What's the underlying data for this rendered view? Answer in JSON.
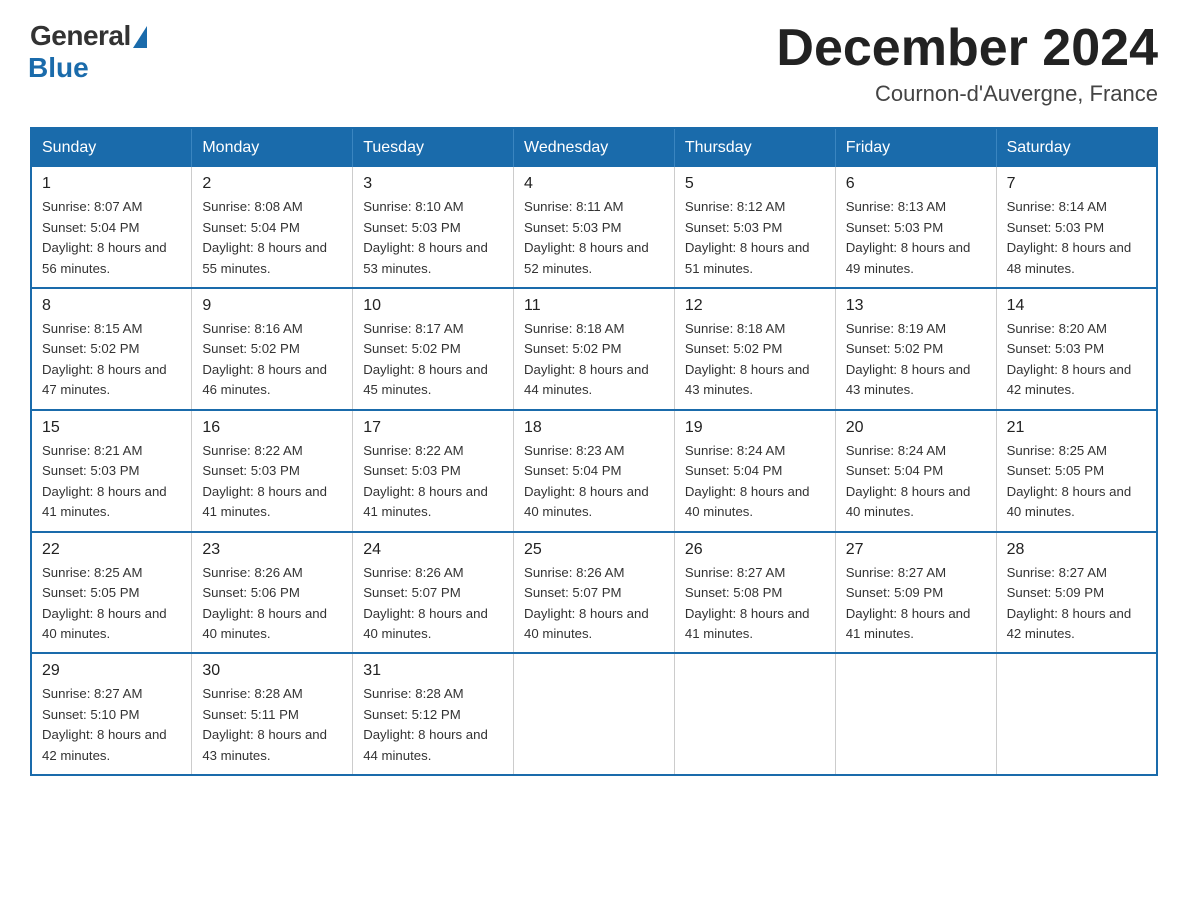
{
  "header": {
    "logo": {
      "general": "General",
      "blue": "Blue"
    },
    "title": "December 2024",
    "location": "Cournon-d'Auvergne, France"
  },
  "days_of_week": [
    "Sunday",
    "Monday",
    "Tuesday",
    "Wednesday",
    "Thursday",
    "Friday",
    "Saturday"
  ],
  "weeks": [
    [
      {
        "day": 1,
        "sunrise": "8:07 AM",
        "sunset": "5:04 PM",
        "daylight": "8 hours and 56 minutes."
      },
      {
        "day": 2,
        "sunrise": "8:08 AM",
        "sunset": "5:04 PM",
        "daylight": "8 hours and 55 minutes."
      },
      {
        "day": 3,
        "sunrise": "8:10 AM",
        "sunset": "5:03 PM",
        "daylight": "8 hours and 53 minutes."
      },
      {
        "day": 4,
        "sunrise": "8:11 AM",
        "sunset": "5:03 PM",
        "daylight": "8 hours and 52 minutes."
      },
      {
        "day": 5,
        "sunrise": "8:12 AM",
        "sunset": "5:03 PM",
        "daylight": "8 hours and 51 minutes."
      },
      {
        "day": 6,
        "sunrise": "8:13 AM",
        "sunset": "5:03 PM",
        "daylight": "8 hours and 49 minutes."
      },
      {
        "day": 7,
        "sunrise": "8:14 AM",
        "sunset": "5:03 PM",
        "daylight": "8 hours and 48 minutes."
      }
    ],
    [
      {
        "day": 8,
        "sunrise": "8:15 AM",
        "sunset": "5:02 PM",
        "daylight": "8 hours and 47 minutes."
      },
      {
        "day": 9,
        "sunrise": "8:16 AM",
        "sunset": "5:02 PM",
        "daylight": "8 hours and 46 minutes."
      },
      {
        "day": 10,
        "sunrise": "8:17 AM",
        "sunset": "5:02 PM",
        "daylight": "8 hours and 45 minutes."
      },
      {
        "day": 11,
        "sunrise": "8:18 AM",
        "sunset": "5:02 PM",
        "daylight": "8 hours and 44 minutes."
      },
      {
        "day": 12,
        "sunrise": "8:18 AM",
        "sunset": "5:02 PM",
        "daylight": "8 hours and 43 minutes."
      },
      {
        "day": 13,
        "sunrise": "8:19 AM",
        "sunset": "5:02 PM",
        "daylight": "8 hours and 43 minutes."
      },
      {
        "day": 14,
        "sunrise": "8:20 AM",
        "sunset": "5:03 PM",
        "daylight": "8 hours and 42 minutes."
      }
    ],
    [
      {
        "day": 15,
        "sunrise": "8:21 AM",
        "sunset": "5:03 PM",
        "daylight": "8 hours and 41 minutes."
      },
      {
        "day": 16,
        "sunrise": "8:22 AM",
        "sunset": "5:03 PM",
        "daylight": "8 hours and 41 minutes."
      },
      {
        "day": 17,
        "sunrise": "8:22 AM",
        "sunset": "5:03 PM",
        "daylight": "8 hours and 41 minutes."
      },
      {
        "day": 18,
        "sunrise": "8:23 AM",
        "sunset": "5:04 PM",
        "daylight": "8 hours and 40 minutes."
      },
      {
        "day": 19,
        "sunrise": "8:24 AM",
        "sunset": "5:04 PM",
        "daylight": "8 hours and 40 minutes."
      },
      {
        "day": 20,
        "sunrise": "8:24 AM",
        "sunset": "5:04 PM",
        "daylight": "8 hours and 40 minutes."
      },
      {
        "day": 21,
        "sunrise": "8:25 AM",
        "sunset": "5:05 PM",
        "daylight": "8 hours and 40 minutes."
      }
    ],
    [
      {
        "day": 22,
        "sunrise": "8:25 AM",
        "sunset": "5:05 PM",
        "daylight": "8 hours and 40 minutes."
      },
      {
        "day": 23,
        "sunrise": "8:26 AM",
        "sunset": "5:06 PM",
        "daylight": "8 hours and 40 minutes."
      },
      {
        "day": 24,
        "sunrise": "8:26 AM",
        "sunset": "5:07 PM",
        "daylight": "8 hours and 40 minutes."
      },
      {
        "day": 25,
        "sunrise": "8:26 AM",
        "sunset": "5:07 PM",
        "daylight": "8 hours and 40 minutes."
      },
      {
        "day": 26,
        "sunrise": "8:27 AM",
        "sunset": "5:08 PM",
        "daylight": "8 hours and 41 minutes."
      },
      {
        "day": 27,
        "sunrise": "8:27 AM",
        "sunset": "5:09 PM",
        "daylight": "8 hours and 41 minutes."
      },
      {
        "day": 28,
        "sunrise": "8:27 AM",
        "sunset": "5:09 PM",
        "daylight": "8 hours and 42 minutes."
      }
    ],
    [
      {
        "day": 29,
        "sunrise": "8:27 AM",
        "sunset": "5:10 PM",
        "daylight": "8 hours and 42 minutes."
      },
      {
        "day": 30,
        "sunrise": "8:28 AM",
        "sunset": "5:11 PM",
        "daylight": "8 hours and 43 minutes."
      },
      {
        "day": 31,
        "sunrise": "8:28 AM",
        "sunset": "5:12 PM",
        "daylight": "8 hours and 44 minutes."
      },
      null,
      null,
      null,
      null
    ]
  ]
}
